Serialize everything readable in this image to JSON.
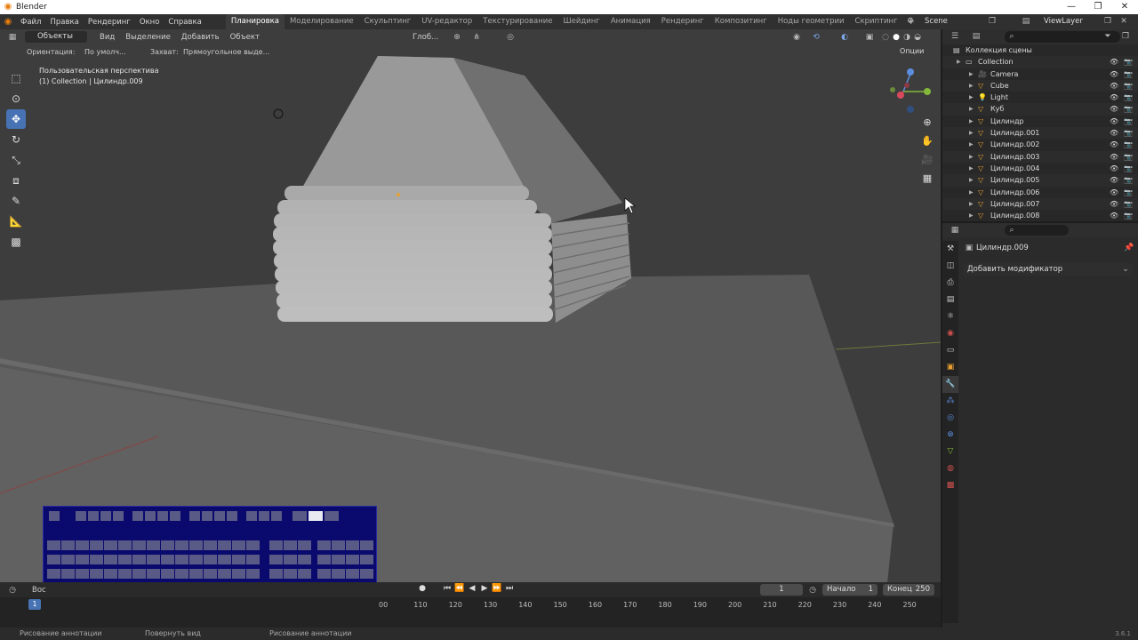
{
  "window": {
    "title": "Blender"
  },
  "menu": [
    "Файл",
    "Правка",
    "Рендеринг",
    "Окно",
    "Справка"
  ],
  "workspaces": [
    {
      "label": "Планировка",
      "active": true
    },
    {
      "label": "Моделирование",
      "active": false
    },
    {
      "label": "Скульптинг",
      "active": false
    },
    {
      "label": "UV-редактор",
      "active": false
    },
    {
      "label": "Текстурирование",
      "active": false
    },
    {
      "label": "Шейдинг",
      "active": false
    },
    {
      "label": "Анимация",
      "active": false
    },
    {
      "label": "Рендеринг",
      "active": false
    },
    {
      "label": "Композитинг",
      "active": false
    },
    {
      "label": "Ноды геометрии",
      "active": false
    },
    {
      "label": "Скриптинг",
      "active": false
    }
  ],
  "scene": "Scene",
  "view_layer": "ViewLayer",
  "viewport": {
    "mode": "Объекты",
    "menu": [
      "Вид",
      "Выделение",
      "Добавить",
      "Объект"
    ],
    "transform_orientation": "Глоб...",
    "orientation_label": "Ориентация:",
    "orientation_value": "По умолч...",
    "snap_label": "Захват:",
    "snap_value": "Прямоугольное выде...",
    "options": "Опции",
    "perspective": "Пользовательская перспектива",
    "collection_info": "(1) Collection | Цилиндр.009"
  },
  "outliner": {
    "root": "Коллекция сцены",
    "collection": "Collection",
    "items": [
      "Camera",
      "Cube",
      "Light",
      "Куб",
      "Цилиндр",
      "Цилиндр.001",
      "Цилиндр.002",
      "Цилиндр.003",
      "Цилиндр.004",
      "Цилиндр.005",
      "Цилиндр.006",
      "Цилиндр.007",
      "Цилиндр.008"
    ]
  },
  "properties": {
    "object_name": "Цилиндр.009",
    "add_modifier": "Добавить модификатор"
  },
  "timeline": {
    "current_frame": "1",
    "start_label": "Начало",
    "start": "1",
    "end_label": "Конец",
    "end": "250",
    "ticks": [
      "00",
      "110",
      "120",
      "130",
      "140",
      "150",
      "160",
      "170",
      "180",
      "190",
      "200",
      "210",
      "220",
      "230",
      "240",
      "250"
    ],
    "marker": "1",
    "playback_label": "Вос"
  },
  "status": {
    "left": "Рисование аннотации",
    "middle": "Повернуть вид",
    "right": "Рисование аннотации",
    "version": "3.6.1"
  },
  "colors": {
    "accent": "#4772b3",
    "brand": "#e87d0d",
    "overlay": "#0a0a6e"
  }
}
